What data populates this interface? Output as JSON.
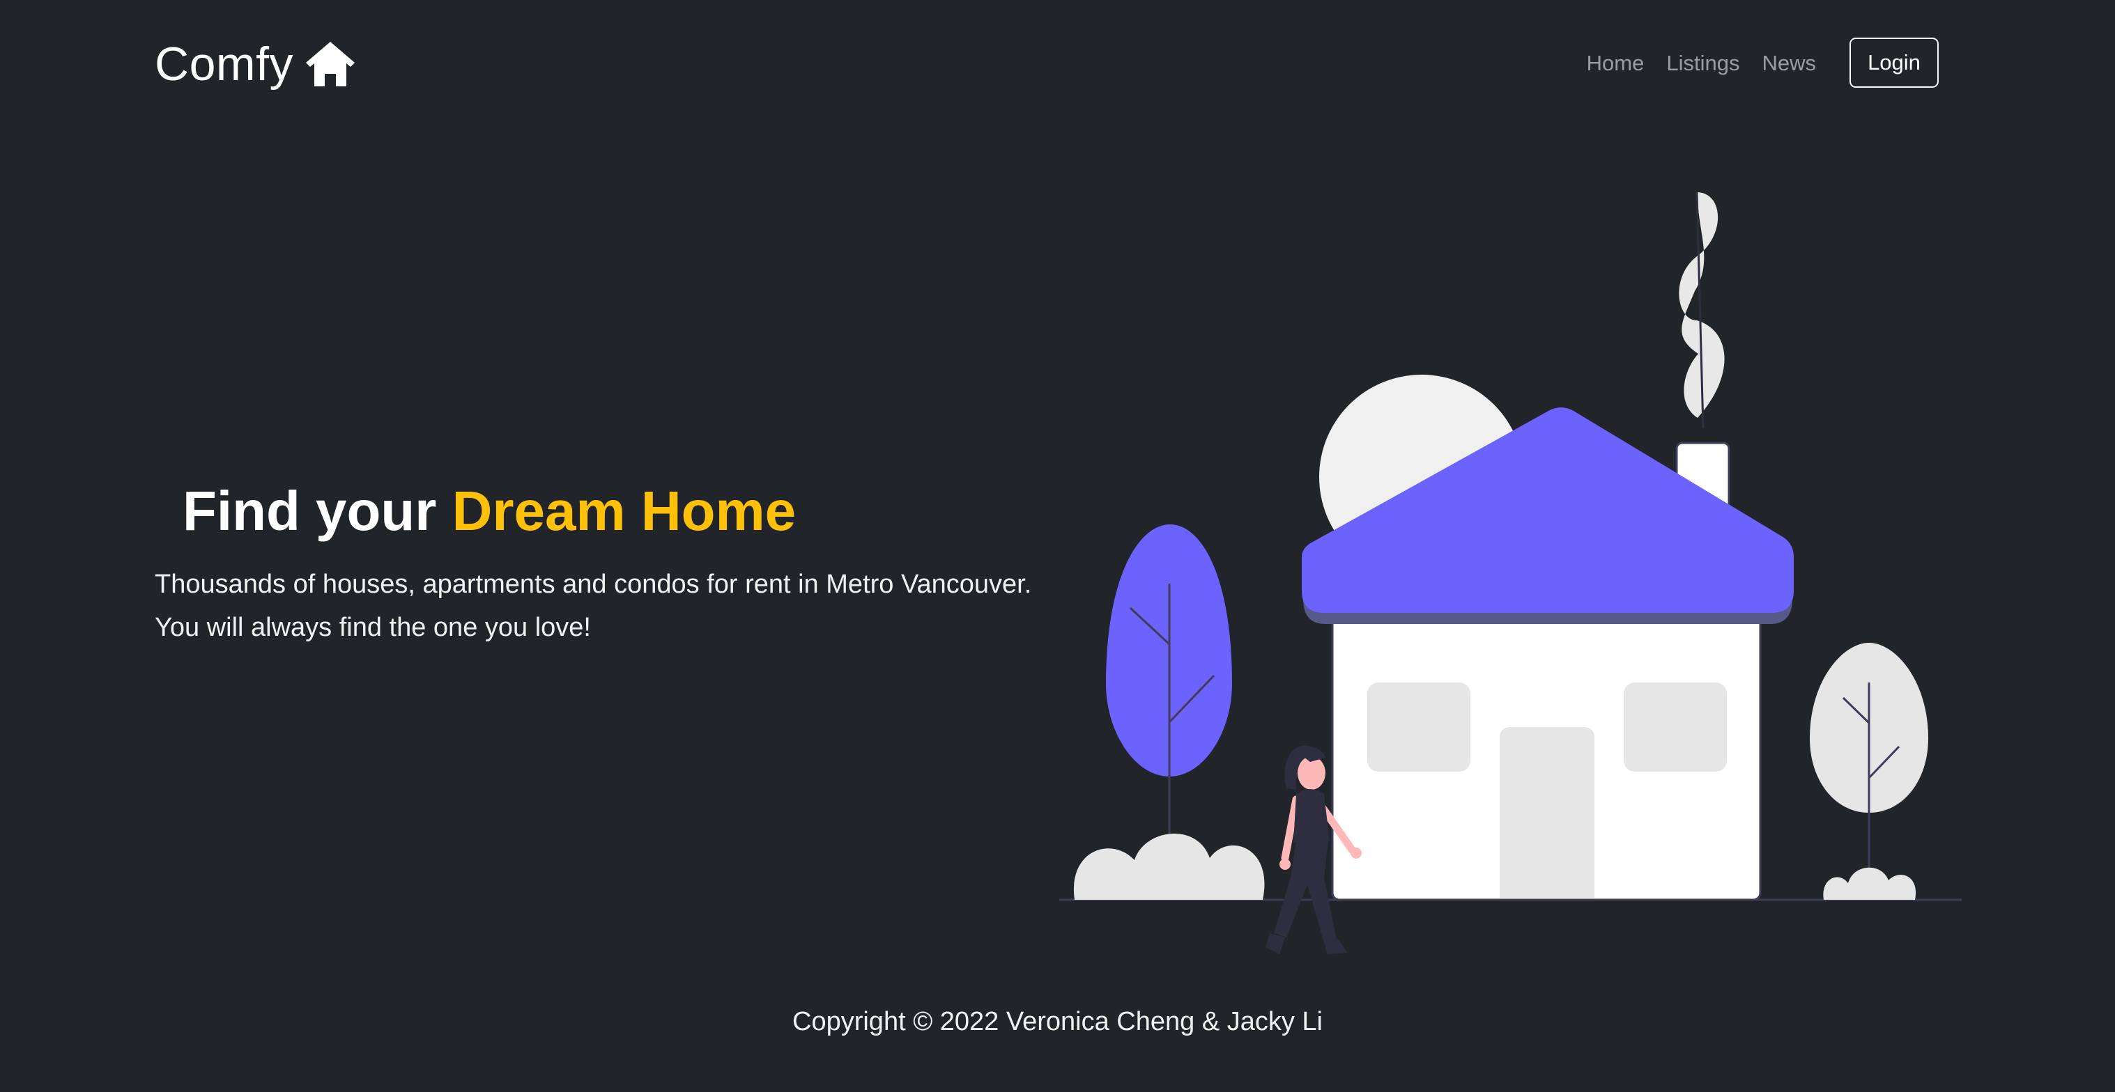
{
  "navbar": {
    "brand": "Comfy",
    "brand_icon": "house-icon",
    "links": [
      "Home",
      "Listings",
      "News"
    ],
    "login_label": "Login"
  },
  "hero": {
    "title_lead": "Find your ",
    "title_accent": "Dream Home",
    "subtitle_line1": "Thousands of houses, apartments and condos for rent in Metro Vancouver.",
    "subtitle_line2": "You will always find the one you love!",
    "illustration": "house-illustration"
  },
  "footer": {
    "copyright": "Copyright © 2022 Veronica Cheng & Jacky Li"
  },
  "colors": {
    "background": "#212529",
    "accent": "#ffc107",
    "illustration_primary": "#6c63ff",
    "nav_link": "rgba(255,255,255,0.55)"
  }
}
